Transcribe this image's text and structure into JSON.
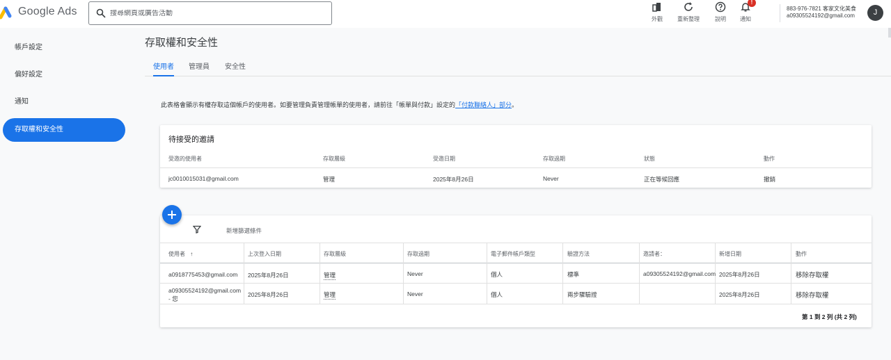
{
  "app": {
    "name": "Google Ads"
  },
  "search": {
    "placeholder": "搜尋網頁或廣告活動"
  },
  "toolbar": {
    "appearance": "外觀",
    "refresh": "重新整理",
    "help": "說明",
    "notifications": "通知",
    "notification_badge": "!"
  },
  "account": {
    "line1": "883-976-7821 客家文化美食",
    "line2": "a09305524192@gmail.com",
    "avatar_letter": "J"
  },
  "sidebar": {
    "items": [
      {
        "label": "帳戶設定"
      },
      {
        "label": "偏好設定"
      },
      {
        "label": "通知"
      },
      {
        "label": "存取權和安全性"
      }
    ]
  },
  "page": {
    "title": "存取權和安全性",
    "tabs": [
      {
        "label": "使用者"
      },
      {
        "label": "管理員"
      },
      {
        "label": "安全性"
      }
    ],
    "info_prefix": "此表格會顯示有權存取這個帳戶的使用者。如要管理負責管理帳單的使用者，請前往「帳單與付款」設定的",
    "info_link": "「付款聯絡人」部分",
    "info_suffix": "。"
  },
  "pending": {
    "title": "待接受的邀請",
    "headers": [
      "受邀的使用者",
      "存取層級",
      "受邀日期",
      "存取過期",
      "狀態",
      "動作"
    ],
    "row": [
      "jc0010015031@gmail.com",
      "管理",
      "2025年8月26日",
      "Never",
      "正在等候回應",
      "撤銷"
    ]
  },
  "users": {
    "filter_label": "新增篩選條件",
    "headers": [
      "使用者",
      "上次登入日期",
      "存取層級",
      "存取過期",
      "電子郵件帳戶類型",
      "驗證方法",
      "邀請者：",
      "新增日期",
      "動作"
    ],
    "sort_icon": "↑",
    "rows": [
      [
        "a0918775453@gmail.com",
        "2025年8月26日",
        "管理",
        "Never",
        "個人",
        "標準",
        "a09305524192@gmail.com",
        "2025年8月26日",
        "移除存取權"
      ],
      [
        "a09305524192@gmail.com",
        "2025年8月26日",
        "管理",
        "Never",
        "個人",
        "兩步驟驗證",
        "",
        "2025年8月26日",
        "移除存取權"
      ]
    ],
    "row2_suffix": "- 您",
    "pagination": "第 1 到 2 列 (共 2 列)"
  },
  "colors": {
    "accent": "#1a73e8",
    "badge": "#d93025"
  }
}
